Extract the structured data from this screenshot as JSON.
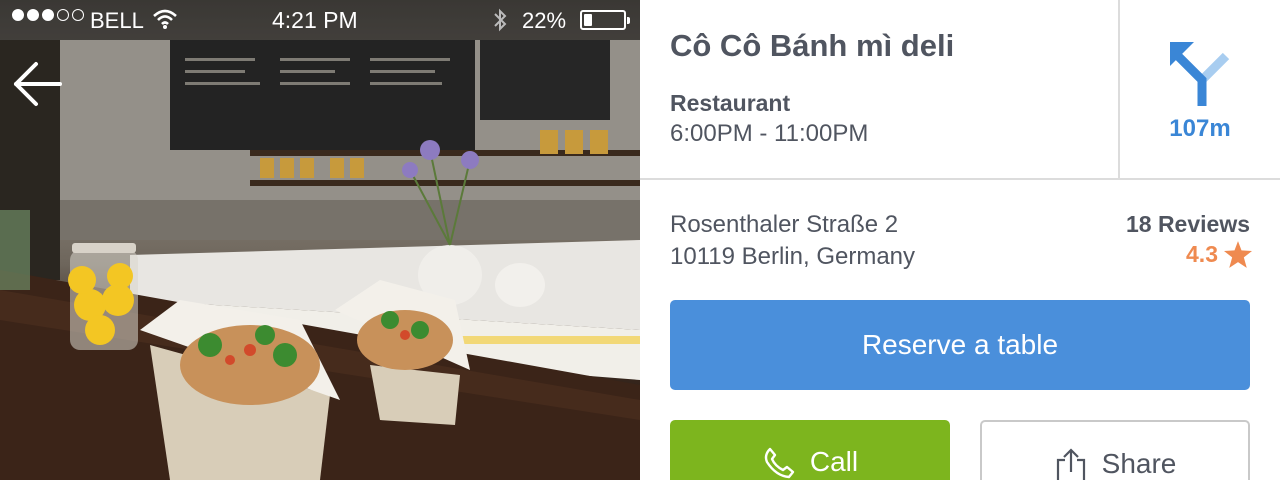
{
  "status_bar": {
    "carrier": "BELL",
    "time": "4:21 PM",
    "battery_percent": "22%",
    "battery_level": 0.22,
    "signal_bars_filled": 3,
    "signal_bars_total": 5
  },
  "place": {
    "name": "Cô Cô Bánh mì deli",
    "category": "Restaurant",
    "hours": "6:00PM - 11:00PM",
    "address_line1": "Rosenthaler Straße 2",
    "address_line2": "10119 Berlin, Germany",
    "reviews_count": "18 Reviews",
    "rating": "4.3",
    "distance": "107m"
  },
  "actions": {
    "reserve_label": "Reserve a table",
    "call_label": "Call",
    "share_label": "Share"
  },
  "icons": {
    "back": "back-arrow-icon",
    "navigation": "turn-left-icon",
    "star": "star-icon",
    "phone": "phone-icon",
    "share": "share-icon",
    "wifi": "wifi-icon",
    "bluetooth": "bluetooth-icon"
  },
  "colors": {
    "accent_blue": "#4a8fdb",
    "distance_blue": "#3a86d6",
    "call_green": "#7db51e",
    "rating_orange": "#ef8a50",
    "text_gray": "#505560"
  }
}
